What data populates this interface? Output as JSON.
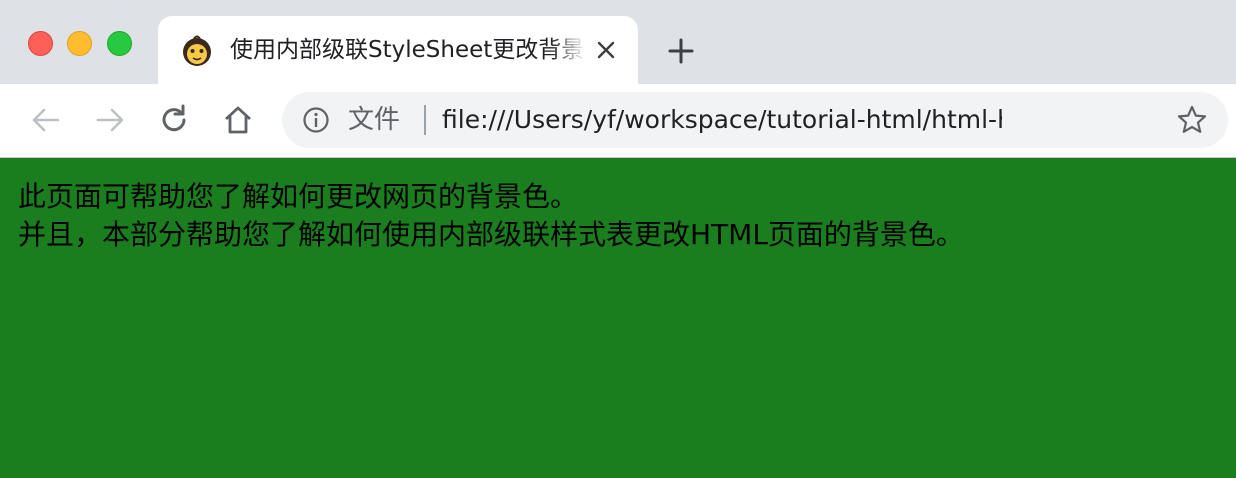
{
  "window": {
    "controls": [
      "close",
      "minimize",
      "maximize"
    ]
  },
  "tab": {
    "title": "使用内部级联StyleSheet更改背景",
    "favicon": "monkey-face-icon",
    "close_icon": "close-icon"
  },
  "toolbar": {
    "back_icon": "back-arrow-icon",
    "forward_icon": "forward-arrow-icon",
    "reload_icon": "reload-icon",
    "home_icon": "home-icon",
    "new_tab_icon": "plus-icon"
  },
  "omnibox": {
    "info_icon": "info-icon",
    "security_label": "文件",
    "url": "file:///Users/yf/workspace/tutorial-html/html-help/un...",
    "bookmark_icon": "star-icon"
  },
  "page": {
    "background_color": "#1b7e1e",
    "line1": "此页面可帮助您了解如何更改网页的背景色。",
    "line2": "并且，本部分帮助您了解如何使用内部级联样式表更改HTML页面的背景色。"
  }
}
